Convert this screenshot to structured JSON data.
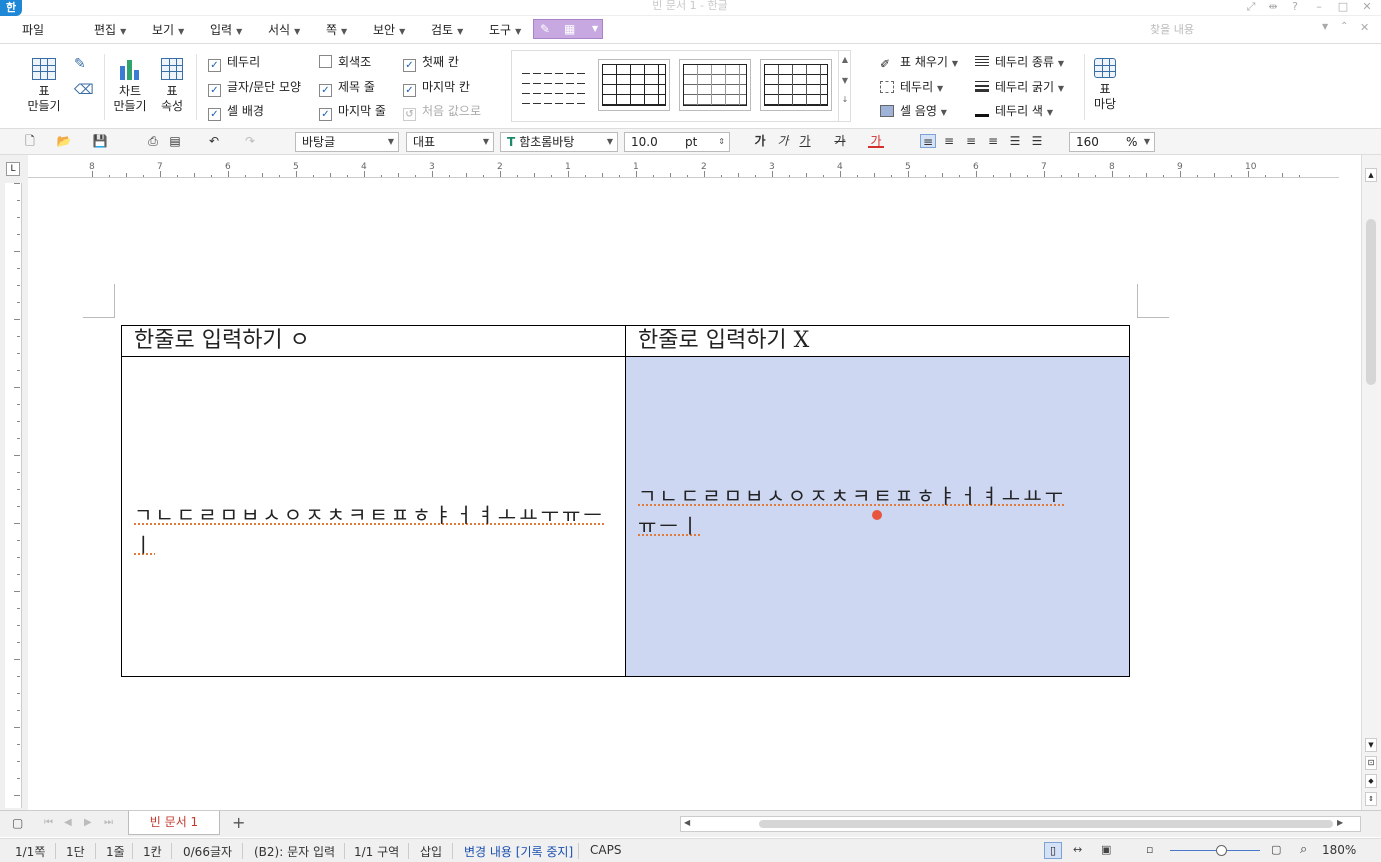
{
  "window": {
    "title": "빈 문서 1 - 한글",
    "app_icon": "한",
    "controls": [
      "⤢",
      "⇹",
      "?",
      "–",
      "□",
      "✕"
    ]
  },
  "menu": {
    "items": [
      {
        "label": "파일"
      },
      {
        "label": "편집"
      },
      {
        "label": "보기"
      },
      {
        "label": "입력"
      },
      {
        "label": "서식"
      },
      {
        "label": "쪽"
      },
      {
        "label": "보안"
      },
      {
        "label": "검토"
      },
      {
        "label": "도구"
      }
    ],
    "search_placeholder": "찾을 내용"
  },
  "ribbon": {
    "table_btn": "표\n만들기",
    "table_btn_label": "표",
    "table_btn_sub": "만들기",
    "chart_btn": "차트",
    "chart_btn_sub": "만들기",
    "props_btn": "표",
    "props_btn_sub": "속성",
    "checkboxes": [
      {
        "label": "테두리",
        "checked": true
      },
      {
        "label": "글자/문단 모양",
        "checked": true
      },
      {
        "label": "셀 배경",
        "checked": true
      },
      {
        "label": "회색조",
        "checked": false
      },
      {
        "label": "제목 줄",
        "checked": true
      },
      {
        "label": "마지막 줄",
        "checked": true
      },
      {
        "label": "첫째 칸",
        "checked": true
      },
      {
        "label": "마지막 칸",
        "checked": true
      },
      {
        "label": "처음 값으로",
        "checked": false,
        "disabled": true
      }
    ],
    "right_tools": [
      {
        "label": "표 채우기"
      },
      {
        "label": "테두리"
      },
      {
        "label": "셀 음영"
      },
      {
        "label": "테두리 종류"
      },
      {
        "label": "테두리 굵기"
      },
      {
        "label": "테두리 색"
      }
    ],
    "madang_btn": "표",
    "madang_btn_sub": "마당"
  },
  "toolbar": {
    "style": "바탕글",
    "lang": "대표",
    "font": "함초롬바탕",
    "size": "10.0",
    "size_unit": "pt",
    "zoom": "160",
    "zoom_unit": "%",
    "char_buttons": [
      "가",
      "가",
      "가",
      "가",
      "가"
    ]
  },
  "ruler": {
    "labels": [
      "8",
      "7",
      "6",
      "5",
      "4",
      "3",
      "2",
      "1",
      "1",
      "2",
      "3",
      "4",
      "5",
      "6",
      "7",
      "8",
      "9",
      "10"
    ]
  },
  "document": {
    "table": {
      "header_left": "한줄로 입력하기 ㅇ",
      "header_right": "한줄로 입력하기 X",
      "body_left": "ㄱㄴㄷㄹㅁㅂㅅㅇㅈㅊㅋㅌㅍㅎㅑㅓㅕㅗㅛㅜㅠㅡㅣ",
      "body_right_line1": "ㄱㄴㄷㄹㅁㅂㅅㅇㅈㅊㅋㅌㅍㅎㅑㅓㅕㅗㅛㅜ",
      "body_right_line2": "ㅠㅡㅣ"
    }
  },
  "tabs": {
    "doc_tab": "빈 문서 1",
    "add": "+"
  },
  "status": {
    "items": [
      "1/1쪽",
      "1단",
      "1줄",
      "1칸",
      "0/66글자",
      "(B2): 문자 입력",
      "1/1 구역",
      "삽입",
      "변경 내용 [기록 중지]",
      "CAPS"
    ],
    "zoom": "180%"
  },
  "colors": {
    "selection": "#cdd7f2",
    "accent": "#1e88d6",
    "track_changes": "#1a4fb0"
  }
}
